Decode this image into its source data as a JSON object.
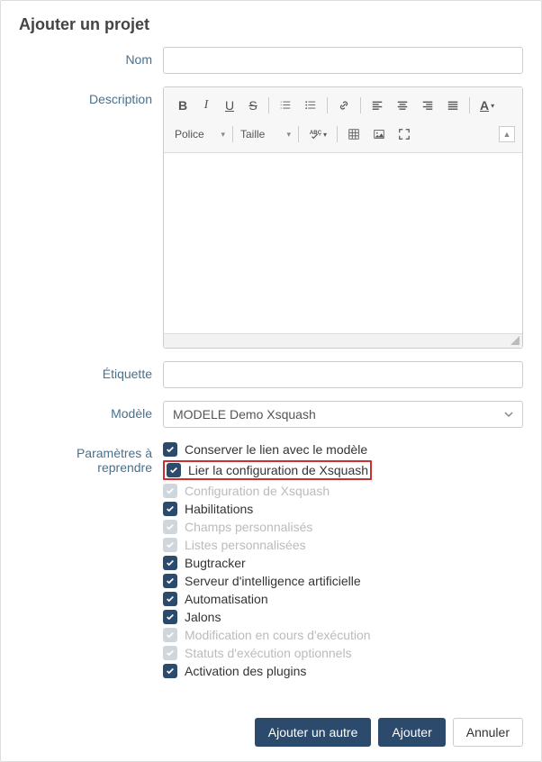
{
  "dialog": {
    "title": "Ajouter un projet"
  },
  "form": {
    "nom_label": "Nom",
    "nom_value": "",
    "description_label": "Description",
    "editor": {
      "font_label": "Police",
      "size_label": "Taille"
    },
    "etiquette_label": "Étiquette",
    "etiquette_value": "",
    "modele_label": "Modèle",
    "modele_value": "MODELE Demo Xsquash",
    "params_label": "Paramètres à reprendre",
    "params": [
      {
        "label": "Conserver le lien avec le modèle",
        "checked": true,
        "disabled": false,
        "highlight": false
      },
      {
        "label": "Lier la configuration de Xsquash",
        "checked": true,
        "disabled": false,
        "highlight": true
      },
      {
        "label": "Configuration de Xsquash",
        "checked": true,
        "disabled": true,
        "highlight": false
      },
      {
        "label": "Habilitations",
        "checked": true,
        "disabled": false,
        "highlight": false
      },
      {
        "label": "Champs personnalisés",
        "checked": true,
        "disabled": true,
        "highlight": false
      },
      {
        "label": "Listes personnalisées",
        "checked": true,
        "disabled": true,
        "highlight": false
      },
      {
        "label": "Bugtracker",
        "checked": true,
        "disabled": false,
        "highlight": false
      },
      {
        "label": "Serveur d'intelligence artificielle",
        "checked": true,
        "disabled": false,
        "highlight": false
      },
      {
        "label": "Automatisation",
        "checked": true,
        "disabled": false,
        "highlight": false
      },
      {
        "label": "Jalons",
        "checked": true,
        "disabled": false,
        "highlight": false
      },
      {
        "label": "Modification en cours d'exécution",
        "checked": true,
        "disabled": true,
        "highlight": false
      },
      {
        "label": "Statuts d'exécution optionnels",
        "checked": true,
        "disabled": true,
        "highlight": false
      },
      {
        "label": "Activation des plugins",
        "checked": true,
        "disabled": false,
        "highlight": false
      }
    ]
  },
  "footer": {
    "add_another": "Ajouter un autre",
    "add": "Ajouter",
    "cancel": "Annuler"
  }
}
